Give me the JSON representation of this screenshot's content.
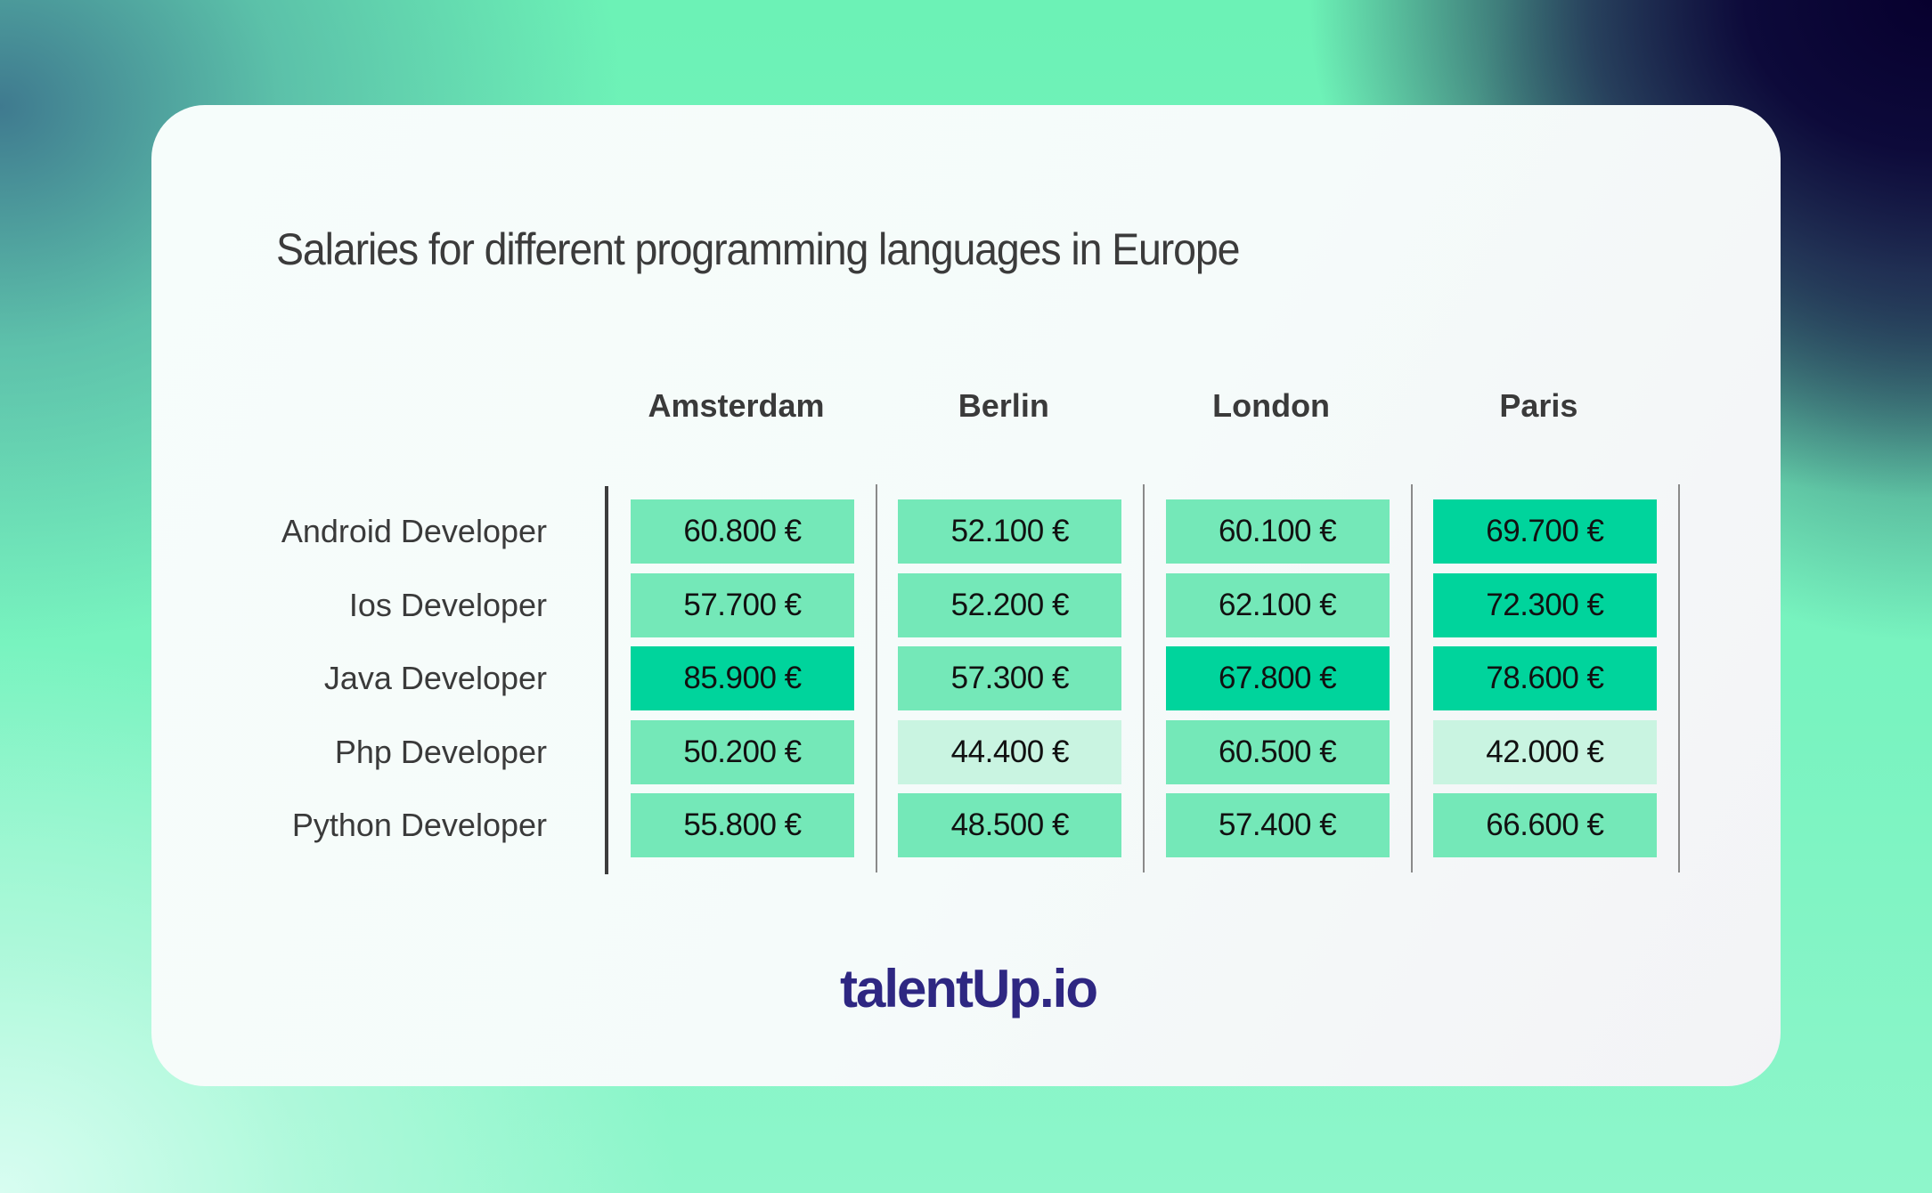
{
  "chart_data": {
    "type": "table",
    "title": "Salaries for different programming languages in Europe",
    "columns": [
      "Amsterdam",
      "Berlin",
      "London",
      "Paris"
    ],
    "rows": [
      "Android Developer",
      "Ios Developer",
      "Java Developer",
      "Php Developer",
      "Python Developer"
    ],
    "values": [
      [
        60800,
        52100,
        60100,
        69700
      ],
      [
        57700,
        52200,
        62100,
        72300
      ],
      [
        85900,
        57300,
        67800,
        78600
      ],
      [
        50200,
        44400,
        60500,
        42000
      ],
      [
        55800,
        48500,
        57400,
        66600
      ]
    ],
    "display": [
      [
        "60.800 €",
        "52.100 €",
        "60.100 €",
        "69.700 €"
      ],
      [
        "57.700 €",
        "52.200 €",
        "62.100 €",
        "72.300 €"
      ],
      [
        "85.900 €",
        "57.300 €",
        "67.800 €",
        "78.600 €"
      ],
      [
        "50.200 €",
        "44.400 €",
        "60.500 €",
        "42.000 €"
      ],
      [
        "55.800 €",
        "48.500 €",
        "57.400 €",
        "66.600 €"
      ]
    ],
    "tiers": [
      [
        "mid",
        "mid",
        "mid",
        "dark"
      ],
      [
        "mid",
        "mid",
        "mid",
        "dark"
      ],
      [
        "dark",
        "mid",
        "dark",
        "dark"
      ],
      [
        "mid",
        "light",
        "mid",
        "light"
      ],
      [
        "mid",
        "mid",
        "mid",
        "mid"
      ]
    ],
    "unit": "EUR"
  },
  "colors": {
    "tier_dark": "#00d49c",
    "tier_mid": "#74e8b8",
    "tier_light": "#c9f4e1",
    "brand": "#2e2782",
    "text": "#3a3a3a"
  },
  "brand": {
    "logo_text": "talentUp.io"
  }
}
